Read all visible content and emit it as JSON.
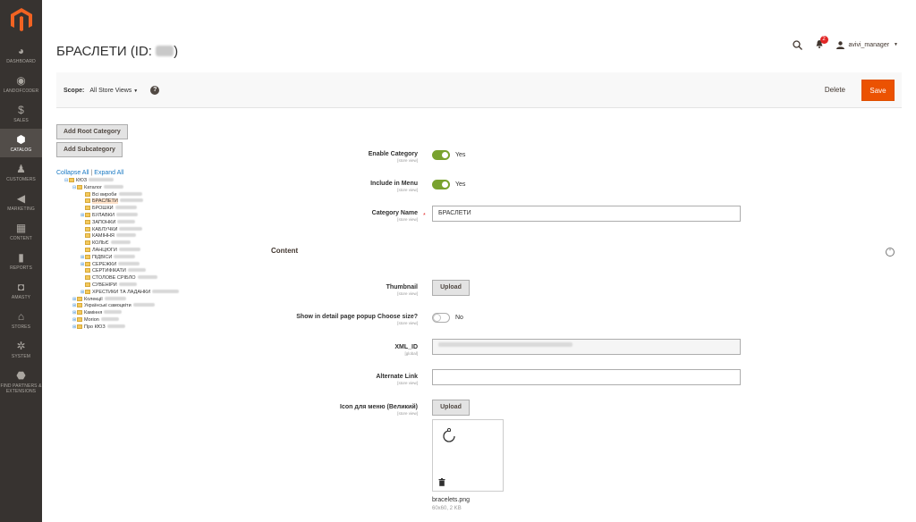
{
  "sidebar": {
    "items": [
      {
        "label": "DASHBOARD",
        "icon": "dashboard-icon",
        "glyph": "◕"
      },
      {
        "label": "LANDOFCODER",
        "icon": "landofcoder-icon",
        "glyph": "◉"
      },
      {
        "label": "SALES",
        "icon": "dollar-icon",
        "glyph": "$"
      },
      {
        "label": "CATALOG",
        "icon": "cube-icon",
        "glyph": "⬢"
      },
      {
        "label": "CUSTOMERS",
        "icon": "person-icon",
        "glyph": "♟"
      },
      {
        "label": "MARKETING",
        "icon": "megaphone-icon",
        "glyph": "◀"
      },
      {
        "label": "CONTENT",
        "icon": "content-icon",
        "glyph": "▦"
      },
      {
        "label": "REPORTS",
        "icon": "bar-chart-icon",
        "glyph": "▮"
      },
      {
        "label": "AMASTY",
        "icon": "amasty-icon",
        "glyph": "◘"
      },
      {
        "label": "STORES",
        "icon": "store-icon",
        "glyph": "⌂"
      },
      {
        "label": "SYSTEM",
        "icon": "gear-icon",
        "glyph": "✲"
      },
      {
        "label": "FIND PARTNERS & EXTENSIONS",
        "icon": "partners-icon",
        "glyph": "⬣"
      }
    ],
    "active": "CATALOG"
  },
  "header": {
    "title": "БРАСЛЕТИ (ID: ",
    "title_end": ")",
    "notifications_count": "2",
    "user": "avivi_manager"
  },
  "toolbar": {
    "scope_label": "Scope:",
    "scope_value": "All Store Views",
    "help": "?",
    "delete_label": "Delete",
    "save_label": "Save"
  },
  "tree_buttons": {
    "add_root": "Add Root Category",
    "add_sub": "Add Subcategory"
  },
  "tree_links": {
    "collapse": "Collapse All",
    "sep": " | ",
    "expand": "Expand All"
  },
  "tree": [
    {
      "label": "КЮЗ",
      "level": 0,
      "pm": "⊟"
    },
    {
      "label": "Каталог",
      "level": 1,
      "pm": "⊟"
    },
    {
      "label": "Всі вироби",
      "level": 2,
      "pm": ""
    },
    {
      "label": "БРАСЛЕТИ",
      "level": 2,
      "pm": "",
      "selected": true
    },
    {
      "label": "БРОШКИ",
      "level": 2,
      "pm": ""
    },
    {
      "label": "БУЛАВКИ",
      "level": 2,
      "pm": "⊞"
    },
    {
      "label": "ЗАПОНКИ",
      "level": 2,
      "pm": ""
    },
    {
      "label": "КАБЛУЧКИ",
      "level": 2,
      "pm": ""
    },
    {
      "label": "КАМІННЯ",
      "level": 2,
      "pm": ""
    },
    {
      "label": "КОЛЬЄ",
      "level": 2,
      "pm": ""
    },
    {
      "label": "ЛАНЦЮГИ",
      "level": 2,
      "pm": ""
    },
    {
      "label": "ПІДВІСИ",
      "level": 2,
      "pm": "⊞"
    },
    {
      "label": "СЕРЕЖКИ",
      "level": 2,
      "pm": "⊞"
    },
    {
      "label": "СЕРТИФІКАТИ",
      "level": 2,
      "pm": ""
    },
    {
      "label": "СТОЛОВЕ СРІБЛО",
      "level": 2,
      "pm": ""
    },
    {
      "label": "СУВЕНІРИ",
      "level": 2,
      "pm": ""
    },
    {
      "label": "ХРЕСТИКИ ТА ЛАДАНКИ",
      "level": 2,
      "pm": "⊞"
    },
    {
      "label": "Колекції",
      "level": 1,
      "pm": "⊞"
    },
    {
      "label": "Українські самоцвіти",
      "level": 1,
      "pm": "⊞"
    },
    {
      "label": "Каміння",
      "level": 1,
      "pm": "⊞"
    },
    {
      "label": "Morion",
      "level": 1,
      "pm": "⊞"
    },
    {
      "label": "Про КЮЗ",
      "level": 1,
      "pm": "⊞"
    }
  ],
  "form": {
    "enable_category": {
      "label": "Enable Category",
      "scope": "[store view]",
      "value": "Yes",
      "on": true
    },
    "include_in_menu": {
      "label": "Include in Menu",
      "scope": "[store view]",
      "value": "Yes",
      "on": true
    },
    "category_name": {
      "label": "Category Name",
      "scope": "[store view]",
      "value": "БРАСЛЕТИ",
      "required": "*"
    },
    "content_title": "Content",
    "thumbnail": {
      "label": "Thumbnail",
      "scope": "[store view]",
      "button": "Upload"
    },
    "choose_size": {
      "label": "Show in detail page popup Choose size?",
      "scope": "[store view]",
      "value": "No",
      "on": false
    },
    "xml_id": {
      "label": "XML_ID",
      "scope": "[global]"
    },
    "alternate_link": {
      "label": "Alternate Link",
      "scope": "[store view]",
      "value": ""
    },
    "icon_menu": {
      "label": "Icon для меню (Великий)",
      "scope": "[store view]",
      "button": "Upload"
    },
    "file_name": "bracelets.png",
    "file_size": "60x60, 2 KB"
  },
  "colors": {
    "sidebar": "#373330",
    "accent": "#eb5202",
    "toggle_on": "#79a22e",
    "link": "#1979c3"
  }
}
